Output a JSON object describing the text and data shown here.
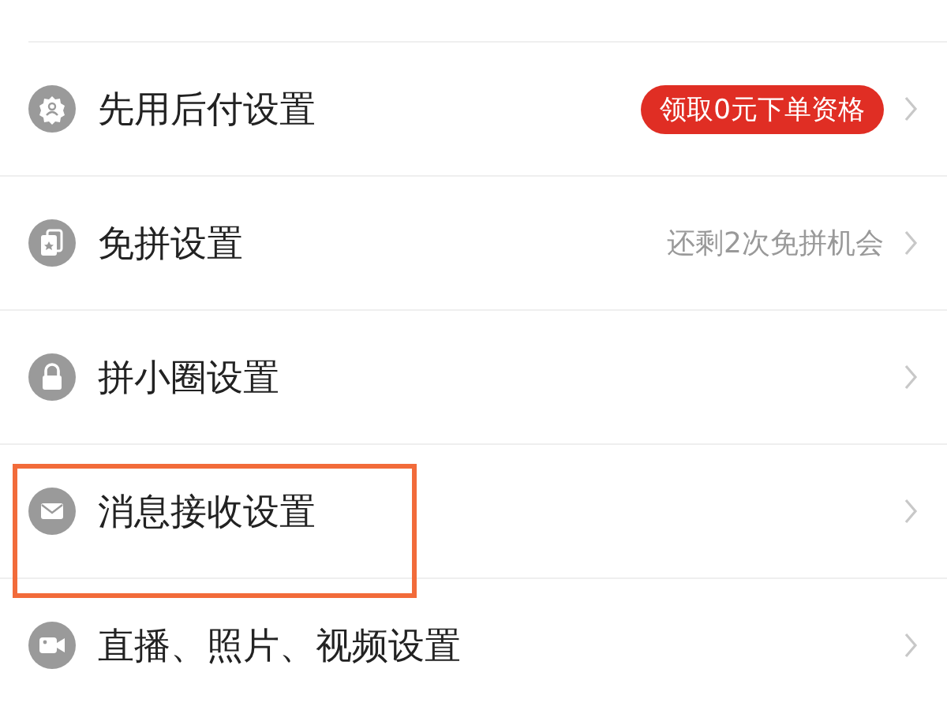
{
  "settings": [
    {
      "label": "先用后付设置",
      "trailing": {
        "kind": "badge",
        "text": "领取0元下单资格"
      },
      "highlighted": false
    },
    {
      "label": "免拼设置",
      "trailing": {
        "kind": "hint",
        "text": "还剩2次免拼机会"
      },
      "highlighted": false
    },
    {
      "label": "拼小圈设置",
      "highlighted": false
    },
    {
      "label": "消息接收设置",
      "highlighted": true
    },
    {
      "label": "直播、照片、视频设置",
      "highlighted": false
    }
  ]
}
